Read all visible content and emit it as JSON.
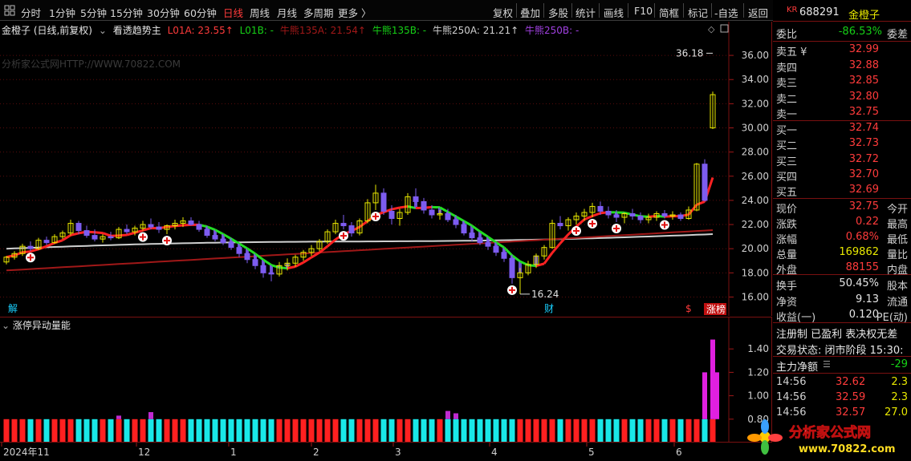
{
  "toolbar": {
    "left_items": [
      "分时",
      "1分钟",
      "5分钟",
      "15分钟",
      "30分钟",
      "60分钟",
      "日线",
      "周线",
      "月线",
      "多周期",
      "更多 〉"
    ],
    "active_item": "日线",
    "right_items": [
      "复权",
      "叠加",
      "多股",
      "统计",
      "画线",
      "F10",
      "简框",
      "标记",
      "-自选",
      "返回"
    ]
  },
  "main_legend": {
    "stock": "金橙子 (日线,前复权)",
    "indicator": "看透趋势主",
    "items": [
      {
        "text": "L01A: 23.55↑",
        "color": "#ff3b3b"
      },
      {
        "text": "L01B: -",
        "color": "#16d016"
      },
      {
        "text": "牛熊135A: 21.54↑",
        "color": "#a01818"
      },
      {
        "text": "牛熊135B: -",
        "color": "#16d016"
      },
      {
        "text": "牛熊250A: 21.21↑",
        "color": "#d0d0d0"
      },
      {
        "text": "牛熊250B: -",
        "color": "#a040e0"
      }
    ]
  },
  "watermark": "分析家公式网HTTP://WWW.70822.COM",
  "sub_legend": "涨停异动量能",
  "markers": {
    "left_label": "解",
    "cai_label": "财",
    "s_label": "$",
    "zhangting_label": "涨榜"
  },
  "chart_data": [
    {
      "type": "candlestick",
      "title": "金橙子 (日线,前复权)",
      "ylim": [
        15.5,
        37.2
      ],
      "y_ticks": [
        16.0,
        18.0,
        20.0,
        22.0,
        24.0,
        26.0,
        28.0,
        30.0,
        32.0,
        34.0,
        36.0
      ],
      "annotations": [
        {
          "text": "36.18",
          "x": 121,
          "y": 36.18
        },
        {
          "text": "16.24",
          "x": 80,
          "y": 16.24
        }
      ],
      "candles": [
        [
          18.9,
          19.4,
          18.7,
          19.3
        ],
        [
          19.3,
          19.8,
          19.1,
          19.6
        ],
        [
          19.6,
          20.4,
          19.4,
          20.2
        ],
        [
          20.2,
          20.6,
          19.8,
          20.0
        ],
        [
          20.0,
          20.9,
          19.9,
          20.7
        ],
        [
          20.7,
          21.0,
          20.3,
          20.5
        ],
        [
          20.5,
          21.2,
          20.4,
          21.0
        ],
        [
          21.0,
          21.5,
          20.8,
          21.3
        ],
        [
          21.3,
          22.4,
          21.1,
          22.1
        ],
        [
          22.1,
          22.3,
          21.2,
          21.5
        ],
        [
          21.5,
          21.9,
          20.9,
          21.1
        ],
        [
          21.1,
          21.6,
          20.6,
          20.8
        ],
        [
          20.8,
          21.2,
          20.5,
          21.0
        ],
        [
          21.0,
          21.4,
          20.7,
          20.9
        ],
        [
          20.9,
          21.8,
          20.8,
          21.6
        ],
        [
          21.6,
          22.0,
          21.2,
          21.4
        ],
        [
          21.4,
          21.9,
          21.1,
          21.7
        ],
        [
          21.7,
          22.3,
          21.5,
          22.0
        ],
        [
          22.0,
          22.5,
          21.6,
          21.8
        ],
        [
          21.8,
          22.2,
          21.3,
          21.6
        ],
        [
          21.6,
          22.0,
          21.2,
          21.9
        ],
        [
          21.9,
          22.4,
          21.6,
          22.1
        ],
        [
          22.1,
          22.6,
          21.8,
          22.3
        ],
        [
          22.3,
          22.6,
          21.9,
          22.0
        ],
        [
          22.0,
          22.3,
          21.4,
          21.6
        ],
        [
          21.6,
          21.9,
          20.9,
          21.1
        ],
        [
          21.1,
          21.5,
          20.6,
          20.8
        ],
        [
          20.8,
          21.2,
          20.3,
          20.5
        ],
        [
          20.5,
          20.9,
          19.9,
          20.1
        ],
        [
          20.1,
          20.4,
          19.3,
          19.6
        ],
        [
          19.6,
          19.9,
          18.8,
          19.1
        ],
        [
          19.1,
          19.5,
          18.3,
          18.6
        ],
        [
          18.6,
          19.0,
          17.6,
          18.0
        ],
        [
          18.0,
          18.6,
          17.3,
          17.9
        ],
        [
          17.9,
          18.9,
          17.7,
          18.6
        ],
        [
          18.6,
          19.2,
          18.2,
          18.8
        ],
        [
          18.8,
          19.5,
          18.5,
          19.3
        ],
        [
          19.3,
          19.9,
          19.0,
          19.7
        ],
        [
          19.7,
          20.3,
          19.4,
          20.0
        ],
        [
          20.0,
          20.8,
          19.8,
          20.6
        ],
        [
          20.6,
          21.6,
          20.4,
          21.4
        ],
        [
          21.4,
          22.4,
          21.2,
          22.1
        ],
        [
          22.1,
          22.8,
          21.6,
          21.9
        ],
        [
          21.9,
          22.2,
          21.0,
          21.3
        ],
        [
          21.3,
          22.5,
          21.1,
          22.3
        ],
        [
          22.3,
          24.1,
          22.1,
          23.8
        ],
        [
          23.8,
          25.3,
          23.2,
          24.6
        ],
        [
          24.6,
          25.0,
          22.8,
          23.1
        ],
        [
          23.1,
          23.6,
          22.0,
          22.5
        ],
        [
          22.5,
          23.3,
          21.9,
          23.0
        ],
        [
          23.0,
          24.6,
          22.8,
          24.3
        ],
        [
          24.3,
          25.0,
          23.6,
          23.9
        ],
        [
          23.9,
          24.2,
          22.9,
          23.2
        ],
        [
          23.2,
          23.6,
          22.5,
          22.8
        ],
        [
          22.8,
          23.2,
          22.4,
          22.9
        ],
        [
          22.9,
          23.3,
          22.2,
          22.4
        ],
        [
          22.4,
          22.8,
          21.7,
          22.0
        ],
        [
          22.0,
          22.3,
          21.1,
          21.3
        ],
        [
          21.3,
          21.6,
          20.6,
          20.9
        ],
        [
          20.9,
          21.3,
          20.3,
          20.5
        ],
        [
          20.5,
          20.9,
          19.9,
          20.2
        ],
        [
          20.2,
          20.5,
          19.4,
          19.7
        ],
        [
          19.7,
          20.0,
          18.9,
          19.2
        ],
        [
          19.2,
          19.5,
          17.1,
          17.6
        ],
        [
          17.6,
          18.4,
          16.24,
          18.0
        ],
        [
          18.0,
          19.0,
          17.8,
          18.7
        ],
        [
          18.7,
          19.6,
          18.4,
          19.4
        ],
        [
          19.4,
          20.3,
          19.1,
          20.1
        ],
        [
          20.1,
          22.4,
          20.0,
          22.1
        ],
        [
          22.1,
          22.7,
          21.6,
          21.9
        ],
        [
          21.9,
          22.6,
          21.5,
          22.4
        ],
        [
          22.4,
          23.0,
          22.0,
          22.7
        ],
        [
          22.7,
          23.3,
          22.3,
          23.0
        ],
        [
          23.0,
          23.8,
          22.6,
          23.5
        ],
        [
          23.5,
          23.9,
          22.8,
          23.1
        ],
        [
          23.1,
          23.5,
          22.5,
          22.8
        ],
        [
          22.8,
          23.2,
          22.2,
          22.6
        ],
        [
          22.6,
          23.0,
          22.1,
          22.9
        ],
        [
          22.9,
          23.3,
          22.4,
          22.7
        ],
        [
          22.7,
          23.0,
          22.1,
          22.4
        ],
        [
          22.4,
          22.9,
          22.1,
          22.6
        ],
        [
          22.6,
          23.1,
          22.3,
          22.9
        ],
        [
          22.9,
          23.2,
          22.5,
          22.7
        ],
        [
          22.7,
          23.1,
          22.4,
          22.8
        ],
        [
          22.8,
          23.0,
          22.3,
          22.5
        ],
        [
          22.5,
          23.5,
          22.4,
          23.2
        ],
        [
          23.2,
          27.1,
          23.1,
          27.0
        ],
        [
          27.0,
          27.4,
          23.9,
          24.0
        ],
        [
          30.0,
          33.0,
          29.9,
          32.75
        ]
      ],
      "series": [
        {
          "name": "L01A",
          "color": "#ff2a2a",
          "start": 0,
          "last": 23.55
        },
        {
          "name": "牛熊135A",
          "color": "#a01818",
          "last": 21.54
        },
        {
          "name": "牛熊250A",
          "color": "#d0d0d0",
          "last": 21.21
        }
      ]
    },
    {
      "type": "bar",
      "title": "涨停异动量能",
      "ylim": [
        0.6,
        1.6
      ],
      "y_ticks": [
        0.8,
        1.0,
        1.2,
        1.4
      ]
    }
  ],
  "date_axis": [
    "2024年11",
    "12",
    "1",
    "2",
    "3",
    "4",
    "5",
    "6"
  ],
  "quote": {
    "code": "688291",
    "name": "金橙子",
    "webi_label": "委比",
    "webi_value": "-86.53%",
    "weicha_label": "委差",
    "asks": [
      {
        "label": "卖五 ¥",
        "price": "32.99"
      },
      {
        "label": "卖四",
        "price": "32.88"
      },
      {
        "label": "卖三",
        "price": "32.85"
      },
      {
        "label": "卖二",
        "price": "32.80"
      },
      {
        "label": "卖一",
        "price": "32.75"
      }
    ],
    "bids": [
      {
        "label": "买一",
        "price": "32.74"
      },
      {
        "label": "买二",
        "price": "32.73"
      },
      {
        "label": "买三",
        "price": "32.72"
      },
      {
        "label": "买四",
        "price": "32.70"
      },
      {
        "label": "买五",
        "price": "32.69"
      }
    ],
    "stats": [
      {
        "label": "现价",
        "value": "32.75",
        "cls": "red",
        "right": "今开"
      },
      {
        "label": "涨跌",
        "value": "0.22",
        "cls": "red",
        "right": "最高"
      },
      {
        "label": "涨幅",
        "value": "0.68%",
        "cls": "red",
        "right": "最低"
      },
      {
        "label": "总量",
        "value": "169862",
        "cls": "yellow",
        "right": "量比"
      },
      {
        "label": "外盘",
        "value": "88155",
        "cls": "red",
        "right": "内盘"
      }
    ],
    "stats2": [
      {
        "label": "换手",
        "value": "50.45%",
        "right": "股本"
      },
      {
        "label": "净资",
        "value": "9.13",
        "right": "流通"
      },
      {
        "label": "收益(一)",
        "value": "0.120",
        "right": "PE(动)"
      }
    ],
    "info1": "注册制 已盈利 表决权无差",
    "info2": "交易状态: 闭市阶段 15:30:",
    "capital_label": "主力净额",
    "capital_value": "-29",
    "ticks": [
      {
        "time": "14:56",
        "price": "32.62",
        "vol": "2.3"
      },
      {
        "time": "14:56",
        "price": "32.59",
        "vol": "2.3"
      },
      {
        "time": "14:56",
        "price": "32.57",
        "vol": "27.0"
      }
    ]
  },
  "logo": {
    "text": "分析家公式网",
    "url": "www.70822.com"
  }
}
